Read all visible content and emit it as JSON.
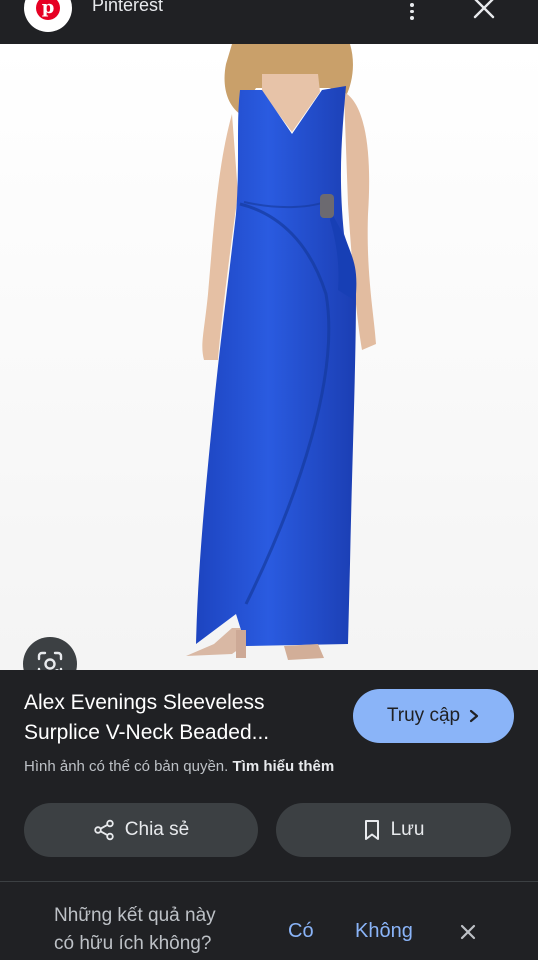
{
  "header": {
    "site_name": "Pinterest",
    "logo_letter": "p"
  },
  "image": {
    "description_icon": "dress-photo"
  },
  "result": {
    "title_line1": "Alex Evenings Sleeveless",
    "title_line2": "Surplice V-Neck Beaded...",
    "visit_label": "Truy cập",
    "copyright_text": "Hình ảnh có thể có bản quyền.",
    "learn_more_label": "Tìm hiểu thêm",
    "share_label": "Chia sẻ",
    "save_label": "Lưu"
  },
  "feedback": {
    "question_line1": "Những kết quả này",
    "question_line2": "có hữu ích không?",
    "yes_label": "Có",
    "no_label": "Không"
  },
  "colors": {
    "background": "#202124",
    "accent": "#8ab4f8",
    "dress": "#1f4fd1",
    "pinterest_red": "#e60023"
  },
  "icons": [
    "pinterest-logo-icon",
    "more-vert-icon",
    "close-icon",
    "lens-icon",
    "chevron-right-icon",
    "share-icon",
    "bookmark-icon"
  ]
}
